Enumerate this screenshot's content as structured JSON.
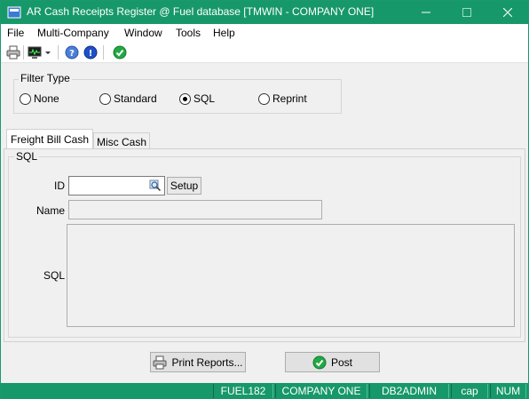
{
  "window": {
    "title": "AR Cash Receipts Register @ Fuel database [TMWIN - COMPANY ONE]",
    "accent_color": "#17986a"
  },
  "menu": [
    "File",
    "Multi-Company",
    "Window",
    "Tools",
    "Help"
  ],
  "toolbar": {
    "icons": [
      "printer-icon",
      "monitor-icon",
      "dropdown-arrow-icon",
      "help-icon",
      "info-icon",
      "check-icon"
    ]
  },
  "filter": {
    "label": "Filter Type",
    "options": [
      "None",
      "Standard",
      "SQL",
      "Reprint"
    ],
    "selected": "SQL"
  },
  "tabs": [
    "Freight Bill Cash",
    "Misc Cash"
  ],
  "active_tab": "Freight Bill Cash",
  "sql_group": {
    "label": "SQL",
    "id_label": "ID",
    "id_value": "",
    "setup_label": "Setup",
    "name_label": "Name",
    "name_value": "",
    "sql_label": "SQL",
    "sql_value": ""
  },
  "buttons": {
    "print_reports": "Print Reports...",
    "post": "Post"
  },
  "status": [
    "FUEL182",
    "COMPANY ONE",
    "DB2ADMIN",
    "cap",
    "NUM"
  ]
}
